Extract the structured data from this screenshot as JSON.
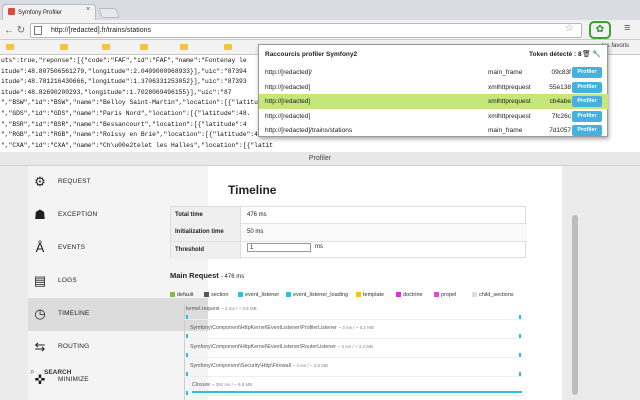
{
  "browser": {
    "tab_title": "Symfony Profiler",
    "tab_close": "×",
    "url": "http://[redacted].fr/trains/stations",
    "bookmarks_right": "les favoris",
    "menu_icon": "hamburger-icon",
    "extension_icon": "symfony-icon"
  },
  "json_lines": [
    "uts\":true,\"reponse\":[{\"code\":\"FAF\",\"id\":\"FAF\",\"name\":\"Fontenay le",
    "itude\":48.807506561279,\"longitude\":2.0409000968933}],\"uic\":\"87394",
    "itude\":48.781216430666,\"longitude\":1.3706331253052}],\"uic\":\"87393",
    "itude\":48.82690200293,\"longitude\":1.7028069496155}],\"uic\":\"87",
    "\",\"BSW\",\"id\":\"BSW\",\"name\":\"Belloy Saint-Martin\",\"location\":[{\"latitude\":4",
    "\",\"GDS\",\"id\":\"GDS\",\"name\":\"Paris Nord\",\"location\":[{\"latitude\":48.",
    "\",\"BSR\",\"id\":\"BSR\",\"name\":\"Bessancourt\",\"location\":[{\"latitude\":4",
    "\",\"RGB\",\"id\":\"RGB\",\"name\":\"Roissy en Brie\",\"location\":[{\"latitude\":4",
    "\",\"CXA\",\"id\":\"CXA\",\"name\":\"Ch\\u00e2telet les Halles\",\"location\":[{\"latit",
    "\",\"RVE\",\"id\":\"RVE\",\"name\":\"Les Clairi\\u00e8res de Verneuil\",\"location\":[{",
    "\",\"RNS\",\"id\":\"RNS\",\"name\":\"Robinson\",\"location\":[{\"latitude\":48.779357910156,\"longitude\":2.2801699300017}],\"uic\":\"8775872\"},",
    "\",\"BSO\",\"id\":\"BSO\",\"name\":\"Bouray\",\"location\":[{\"latitude\":48.533098069385,\"longitude\":2.290619801357}],"
  ],
  "popup": {
    "title": "Raccourcis profiler Symfony2",
    "token_label": "Token détecté : 8",
    "trash_icon": "trash-icon",
    "wrench_icon": "wrench-icon",
    "button_label": "Profiler",
    "rows": [
      {
        "url": "http://[redacted]/",
        "type": "main_frame",
        "token": "09c83f",
        "highlighted": false
      },
      {
        "url": "http://[redacted]",
        "type": "xmlhttprequest",
        "token": "55e138",
        "highlighted": false
      },
      {
        "url": "http://[redacted]",
        "type": "xmlhttprequest",
        "token": "cb4abe",
        "highlighted": true
      },
      {
        "url": "http://[redacted]",
        "type": "xmlhttprequest",
        "token": "7fc26c",
        "highlighted": false
      },
      {
        "url": "http://[redacted]/trains/stations",
        "type": "main_frame",
        "token": "7d1057",
        "highlighted": false
      }
    ]
  },
  "profiler": {
    "window_title": "Profiler",
    "nav": [
      {
        "label": "REQUEST",
        "icon": "gears-icon",
        "selected": false
      },
      {
        "label": "EXCEPTION",
        "icon": "ghost-icon",
        "selected": false
      },
      {
        "label": "EVENTS",
        "icon": "antenna-icon",
        "selected": false
      },
      {
        "label": "LOGS",
        "icon": "book-icon",
        "selected": false
      },
      {
        "label": "TIMELINE",
        "icon": "clock-icon",
        "selected": true
      },
      {
        "label": "ROUTING",
        "icon": "signpost-icon",
        "selected": false
      },
      {
        "label": "MINIMIZE",
        "icon": "minimize-icon",
        "selected": false
      }
    ],
    "search_label": "SEARCH",
    "heading": "Timeline",
    "metrics": [
      {
        "label": "Total time",
        "value": "476 ms"
      },
      {
        "label": "Initialization time",
        "value": "50 ms"
      },
      {
        "label": "Threshold",
        "value": "",
        "input": "1",
        "unit": "ms"
      }
    ],
    "main_request_title": "Main Request",
    "main_request_time": "- 476 ms",
    "legend": [
      {
        "label": "default",
        "color": "#7cc341"
      },
      {
        "label": "section",
        "color": "#555555"
      },
      {
        "label": "event_listener",
        "color": "#29c1e6"
      },
      {
        "label": "event_listener_loading",
        "color": "#29c1e6"
      },
      {
        "label": "template",
        "color": "#f8c418"
      },
      {
        "label": "doctrine",
        "color": "#e12be1"
      },
      {
        "label": "propel",
        "color": "#e14ad6"
      },
      {
        "label": "child_sections",
        "color": "#dddddd"
      }
    ],
    "timeline_rows": [
      {
        "name": "kernel.request",
        "info": "~ 3 ms / ~ 3.5 MB"
      },
      {
        "name": "Symfony\\Component\\HttpKernel\\EventListener\\ProfilerListener",
        "info": "~ 3 ms / ~ 5.2 MB"
      },
      {
        "name": "Symfony\\Component\\HttpKernel\\EventListener\\RouterListener",
        "info": "~ 3 ms / ~ 3.2 MB"
      },
      {
        "name": "Symfony\\Component\\Security\\Http\\Firewall",
        "info": "~ 3 ms / ~ 3.5 MB"
      },
      {
        "name": "Closure",
        "info": "~ 392 ms / ~ 6.8 MB"
      }
    ]
  }
}
